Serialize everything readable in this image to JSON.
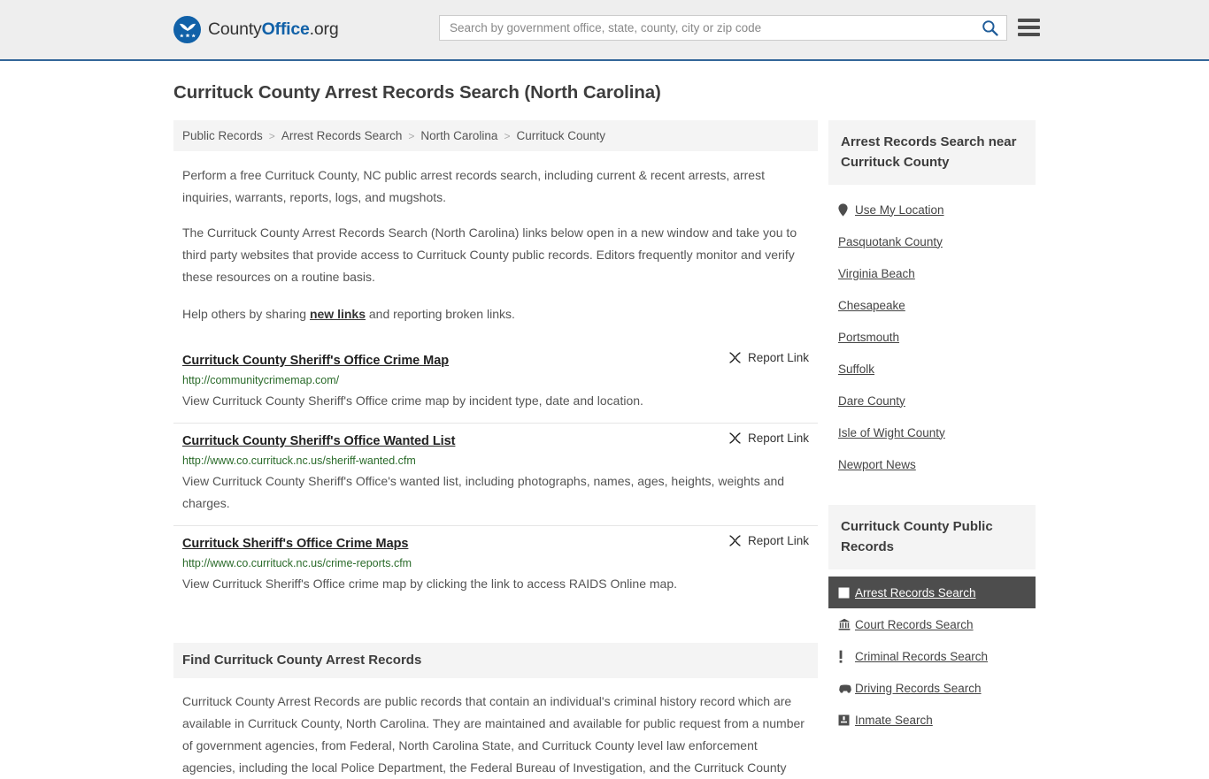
{
  "header": {
    "logo": {
      "icon": "eagle-seal-icon",
      "text_county": "County",
      "text_office": "Office",
      "text_org": ".org"
    },
    "search": {
      "placeholder": "Search by government office, state, county, city or zip code",
      "value": "",
      "icon": "search-icon"
    },
    "menu_icon": "hamburger-menu-icon",
    "background": "#eeeeee",
    "accent": "#336699"
  },
  "page": {
    "title": "Currituck County Arrest Records Search (North Carolina)"
  },
  "breadcrumb": {
    "separator": ">",
    "items": [
      {
        "label": "Public Records"
      },
      {
        "label": "Arrest Records Search"
      },
      {
        "label": "North Carolina"
      },
      {
        "label": "Currituck County"
      }
    ]
  },
  "intro": {
    "paragraph1": "Perform a free Currituck County, NC public arrest records search, including current & recent arrests, arrest inquiries, warrants, reports, logs, and mugshots.",
    "paragraph2": "The Currituck County Arrest Records Search (North Carolina) links below open in a new window and take you to third party websites that provide access to Currituck County public records. Editors frequently monitor and verify these resources on a routine basis.",
    "share_prefix": "Help others by sharing ",
    "share_link": "new links",
    "share_suffix": " and reporting broken links."
  },
  "results": {
    "report_label": "Report Link",
    "report_icon": "broken-link-icon",
    "items": [
      {
        "title": "Currituck County Sheriff's Office Crime Map",
        "url": "http://communitycrimemap.com/",
        "description": "View Currituck County Sheriff's Office crime map by incident type, date and location."
      },
      {
        "title": "Currituck County Sheriff's Office Wanted List",
        "url": "http://www.co.currituck.nc.us/sheriff-wanted.cfm",
        "description": "View Currituck County Sheriff's Office's wanted list, including photographs, names, ages, heights, weights and charges."
      },
      {
        "title": "Currituck Sheriff's Office Crime Maps",
        "url": "http://www.co.currituck.nc.us/crime-reports.cfm",
        "description": "View Currituck Sheriff's Office crime map by clicking the link to access RAIDS Online map."
      }
    ]
  },
  "find_section": {
    "heading": "Find Currituck County Arrest Records",
    "body": "Currituck County Arrest Records are public records that contain an individual's criminal history record which are available in Currituck County, North Carolina. They are maintained and available for public request from a number of government agencies, from Federal, North Carolina State, and Currituck County level law enforcement agencies, including the local Police Department, the Federal Bureau of Investigation, and the Currituck County"
  },
  "sidebar": {
    "nearby": {
      "heading": "Arrest Records Search near Currituck County",
      "items": [
        {
          "label": "Use My Location",
          "icon": "map-pin-icon"
        },
        {
          "label": "Pasquotank County",
          "icon": ""
        },
        {
          "label": "Virginia Beach",
          "icon": ""
        },
        {
          "label": "Chesapeake",
          "icon": ""
        },
        {
          "label": "Portsmouth",
          "icon": ""
        },
        {
          "label": "Suffolk",
          "icon": ""
        },
        {
          "label": "Dare County",
          "icon": ""
        },
        {
          "label": "Isle of Wight County",
          "icon": ""
        },
        {
          "label": "Newport News",
          "icon": ""
        }
      ]
    },
    "public_records": {
      "heading": "Currituck County Public Records",
      "active_background": "#4d4d4d",
      "items": [
        {
          "label": "Arrest Records Search",
          "icon": "white-square-icon",
          "active": true
        },
        {
          "label": "Court Records Search",
          "icon": "courthouse-icon",
          "active": false
        },
        {
          "label": "Criminal Records Search",
          "icon": "exclamation-icon",
          "active": false
        },
        {
          "label": "Driving Records Search",
          "icon": "car-icon",
          "active": false
        },
        {
          "label": "Inmate Search",
          "icon": "inmate-icon",
          "active": false
        }
      ]
    }
  }
}
